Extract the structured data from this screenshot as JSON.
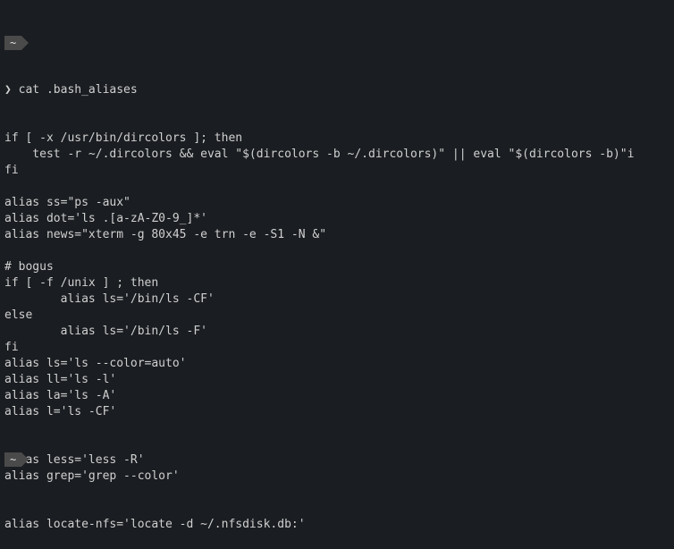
{
  "prompt1": {
    "cwd_indicator": "~",
    "caret": "❯",
    "command": "cat .bash_aliases"
  },
  "output_lines": [
    "if [ -x /usr/bin/dircolors ]; then",
    "    test -r ~/.dircolors && eval \"$(dircolors -b ~/.dircolors)\" || eval \"$(dircolors -b)\"i",
    "fi",
    "",
    "alias ss=\"ps -aux\"",
    "alias dot='ls .[a-zA-Z0-9_]*'",
    "alias news=\"xterm -g 80x45 -e trn -e -S1 -N &\"",
    "",
    "# bogus",
    "if [ -f /unix ] ; then",
    "        alias ls='/bin/ls -CF'",
    "else",
    "        alias ls='/bin/ls -F'",
    "fi",
    "alias ls='ls --color=auto'",
    "alias ll='ls -l'",
    "alias la='ls -A'",
    "alias l='ls -CF'",
    "",
    "",
    "alias less='less -R'",
    "alias grep='grep --color'",
    "",
    "",
    "alias locate-nfs='locate -d ~/.nfsdisk.db:'"
  ],
  "prompt2": {
    "cwd_indicator": "~"
  }
}
